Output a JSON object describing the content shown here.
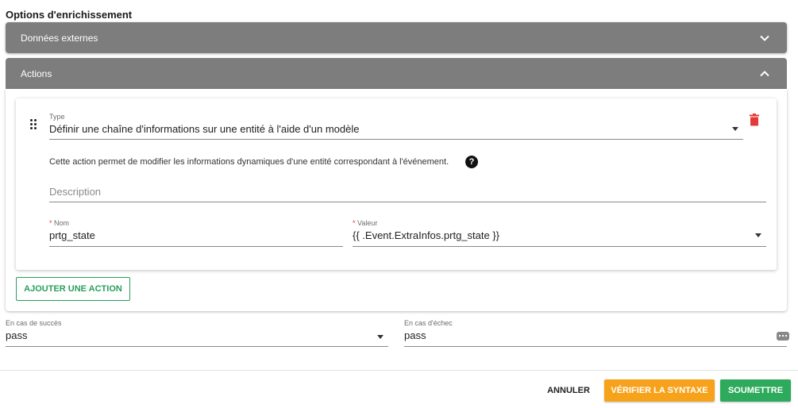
{
  "page": {
    "section_title": "Options d'enrichissement"
  },
  "panels": {
    "external": {
      "label": "Données externes",
      "icon": "chevron-down-icon"
    },
    "actions": {
      "label": "Actions",
      "icon": "chevron-up-icon"
    }
  },
  "action": {
    "type_label": "Type",
    "type_value": "Définir une chaîne d'informations sur une entité à l'aide d'un modèle",
    "help_text": "Cette action permet de modifier les informations dynamiques d'une entité correspondant à l'événement.",
    "help_icon": "?",
    "description_placeholder": "Description",
    "name_label": "Nom",
    "name_value": "prtg_state",
    "value_label": "Valeur",
    "value_value": "{{ .Event.ExtraInfos.prtg_state }}",
    "required_mark": "*"
  },
  "add_action_label": "AJOUTER UNE ACTION",
  "outcomes": {
    "success_label": "En cas de succès",
    "success_value": "pass",
    "failure_label": "En cas d'échec",
    "failure_value": "pass"
  },
  "footer": {
    "cancel": "ANNULER",
    "verify": "VÉRIFIER LA SYNTAXE",
    "submit": "SOUMETTRE"
  },
  "colors": {
    "panel_header": "#7d7d7d",
    "delete": "#e53935",
    "verify_button": "#f7a21b",
    "submit_button": "#2eaa5c",
    "outline_button": "#27a05a"
  }
}
